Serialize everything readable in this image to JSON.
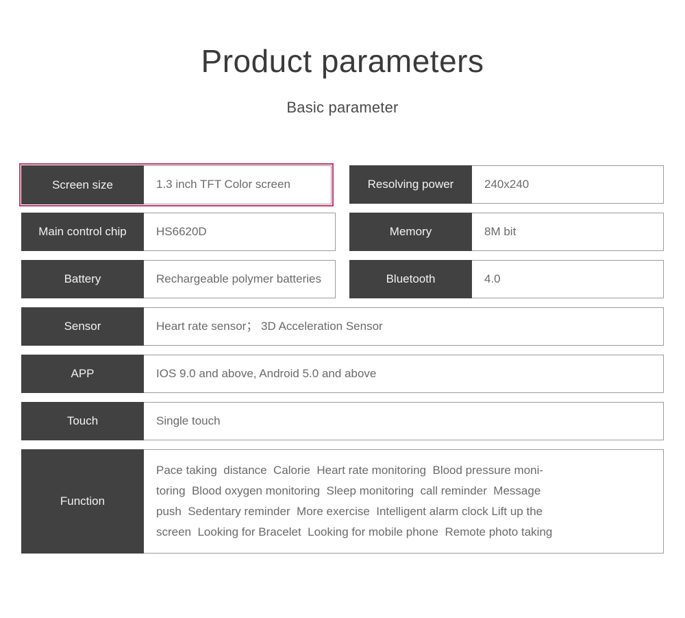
{
  "header": {
    "title": "Product parameters",
    "subtitle": "Basic parameter"
  },
  "colors": {
    "label_bg": "#414141",
    "label_text": "#f2f2f2",
    "value_text": "#6a6a6a",
    "value_border": "#9a9a9a",
    "highlight_border": "#c2396f",
    "page_bg": "#ffffff"
  },
  "specs": {
    "screen_size": {
      "label": "Screen size",
      "value": "1.3  inch TFT Color screen",
      "highlighted": true
    },
    "resolving_power": {
      "label": "Resolving power",
      "value": "240x240"
    },
    "main_control_chip": {
      "label": "Main control chip",
      "value": "HS6620D"
    },
    "memory": {
      "label": "Memory",
      "value": "8M bit"
    },
    "battery": {
      "label": "Battery",
      "value": "Rechargeable polymer batteries"
    },
    "bluetooth": {
      "label": "Bluetooth",
      "value": "4.0"
    },
    "sensor": {
      "label": "Sensor",
      "value": "Heart rate sensor； 3D Acceleration Sensor"
    },
    "app": {
      "label": "APP",
      "value": "IOS 9.0 and above,  Android 5.0 and above"
    },
    "touch": {
      "label": "Touch",
      "value": "Single touch"
    },
    "function": {
      "label": "Function",
      "value_line1": "Pace taking  distance  Calorie  Heart rate monitoring  Blood pressure moni-",
      "value_line2": "toring  Blood oxygen monitoring  Sleep monitoring  call reminder  Message",
      "value_line3": "push  Sedentary reminder  More exercise  Intelligent alarm clock Lift up the",
      "value_line4": "screen  Looking for Bracelet  Looking for mobile phone  Remote photo taking"
    }
  }
}
